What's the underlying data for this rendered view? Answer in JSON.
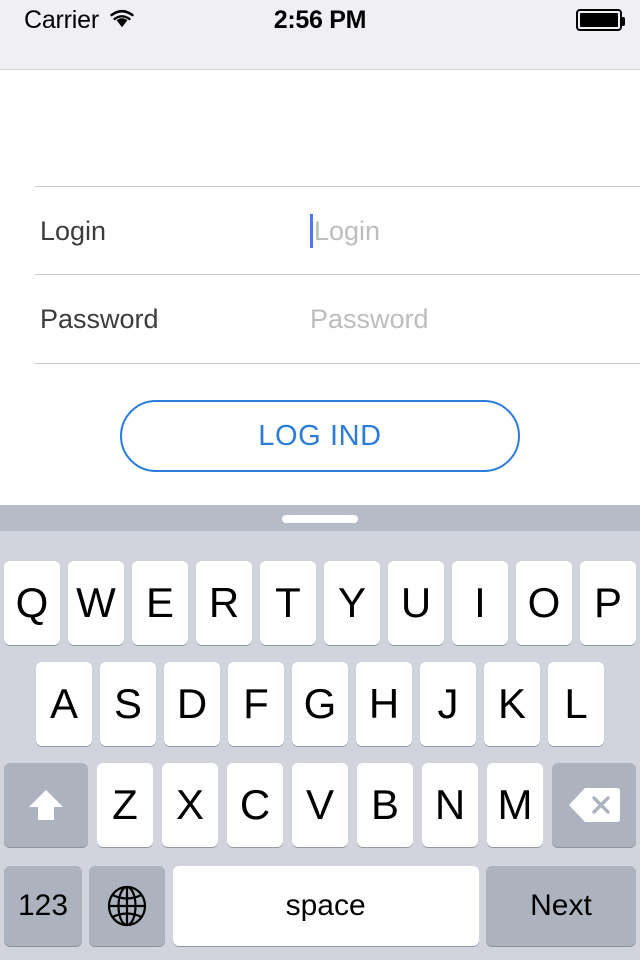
{
  "status_bar": {
    "carrier": "Carrier",
    "wifi_icon": "wifi-icon",
    "time": "2:56 PM",
    "battery_icon": "battery-full-icon"
  },
  "form": {
    "rows": [
      {
        "label": "Login",
        "placeholder": "Login",
        "value": "",
        "focused": true
      },
      {
        "label": "Password",
        "placeholder": "Password",
        "value": "",
        "focused": false
      }
    ],
    "submit_label": "LOG IND"
  },
  "colors": {
    "accent": "#2c7ddb",
    "caret": "#4a7aec",
    "status_bar_bg": "#efeff4",
    "separator": "#c8c7cc",
    "placeholder_text": "#bdbdbd",
    "label_text": "#3c3c3c",
    "keyboard_bg": "#d1d4dc",
    "key_bg": "#ffffff",
    "key_mod_bg": "#adb3be",
    "toolbar_bg": "#b6bcc7"
  },
  "keyboard": {
    "grabber": "keyboard-grabber-handle",
    "row1": [
      "Q",
      "W",
      "E",
      "R",
      "T",
      "Y",
      "U",
      "I",
      "O",
      "P"
    ],
    "row2": [
      "A",
      "S",
      "D",
      "F",
      "G",
      "H",
      "J",
      "K",
      "L"
    ],
    "row3": [
      "Z",
      "X",
      "C",
      "V",
      "B",
      "N",
      "M"
    ],
    "shift_icon": "shift-icon",
    "backspace_icon": "backspace-icon",
    "numeric_label": "123",
    "globe_icon": "globe-icon",
    "space_label": "space",
    "return_label": "Next"
  }
}
